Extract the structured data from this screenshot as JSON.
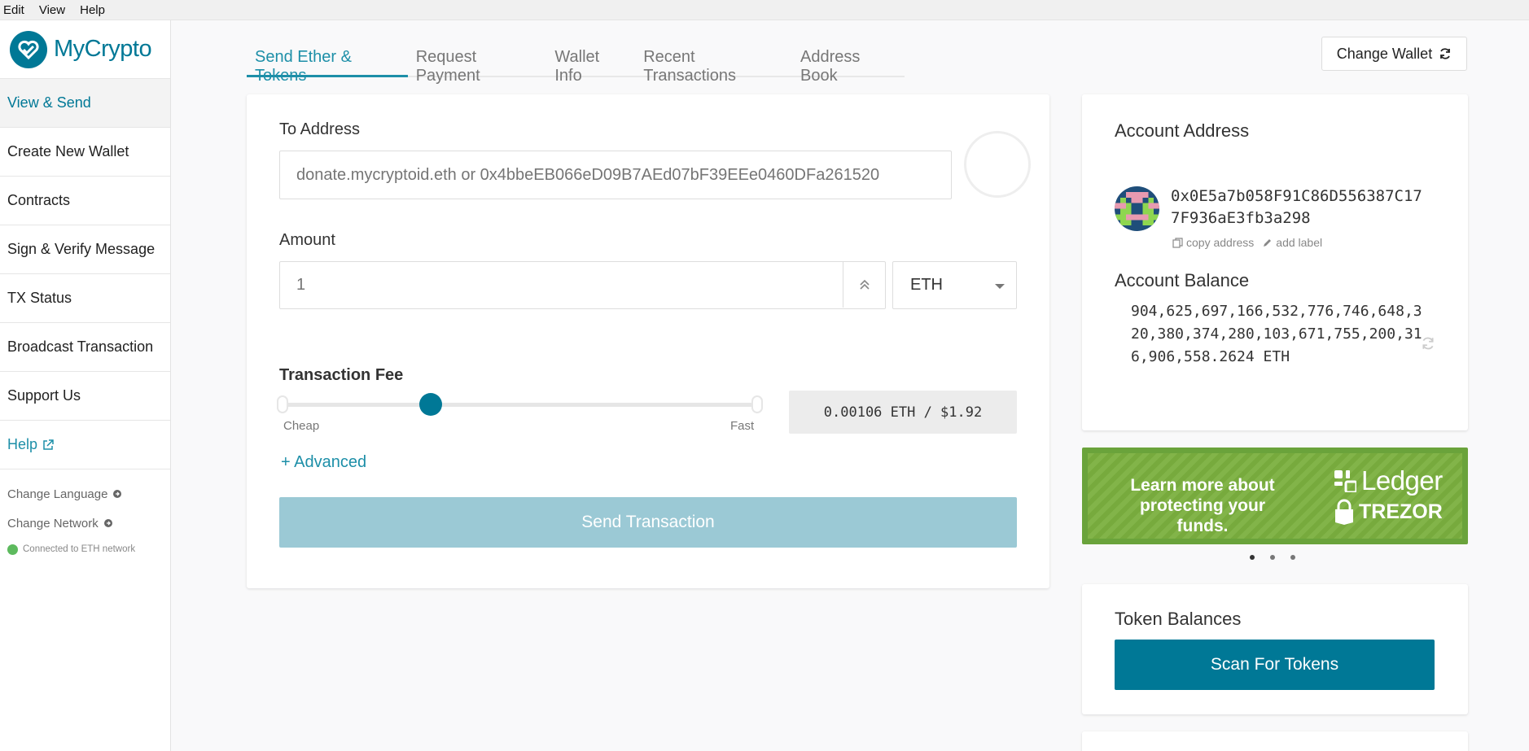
{
  "menubar": {
    "items": [
      "Edit",
      "View",
      "Help"
    ]
  },
  "brand": {
    "name": "MyCrypto",
    "accent": "#007896"
  },
  "sidebar": {
    "items": [
      {
        "label": "View & Send",
        "active": true
      },
      {
        "label": "Create New Wallet"
      },
      {
        "label": "Contracts"
      },
      {
        "label": "Sign & Verify Message"
      },
      {
        "label": "TX Status"
      },
      {
        "label": "Broadcast Transaction"
      },
      {
        "label": "Support Us"
      },
      {
        "label": "Help",
        "icon": "external-link-icon"
      }
    ],
    "change_language": "Change Language",
    "change_network": "Change Network",
    "network_status": "Connected to ETH network",
    "network_status_color": "#5dba5e"
  },
  "tabs": [
    {
      "label": "Send Ether & Tokens",
      "active": true
    },
    {
      "label": "Request Payment"
    },
    {
      "label": "Wallet Info"
    },
    {
      "label": "Recent Transactions"
    },
    {
      "label": "Address Book"
    }
  ],
  "change_wallet": {
    "label": "Change Wallet",
    "icon": "refresh-icon"
  },
  "send_form": {
    "to_address_label": "To Address",
    "to_address_placeholder": "donate.mycryptoid.eth or 0x4bbeEB066eD09B7AEd07bF39EEe0460DFa261520",
    "to_address_value": "",
    "amount_label": "Amount",
    "amount_placeholder": "1",
    "amount_value": "",
    "unit": "ETH",
    "fee_label": "Transaction Fee",
    "fee_slider_level": 0.31,
    "fee_cheap_label": "Cheap",
    "fee_fast_label": "Fast",
    "fee_value": "0.00106 ETH / $1.92",
    "advanced_label": "+ Advanced",
    "send_label": "Send Transaction"
  },
  "account": {
    "address_title": "Account Address",
    "address": "0x0E5a7b058F91C86D556387C177F936aE3fb3a298",
    "copy_label": "copy address",
    "add_label": "add label",
    "balance_title": "Account Balance",
    "balance": "904,625,697,166,532,776,746,648,320,380,374,280,103,671,755,200,316,906,558.2624 ETH"
  },
  "promo": {
    "text": "Learn more about protecting your funds.",
    "brand_1": "Ledger",
    "brand_2": "TREZOR",
    "color": "#7bb03f",
    "slides": 3,
    "active_slide": 0
  },
  "tokens": {
    "title": "Token Balances",
    "scan_label": "Scan For Tokens"
  }
}
